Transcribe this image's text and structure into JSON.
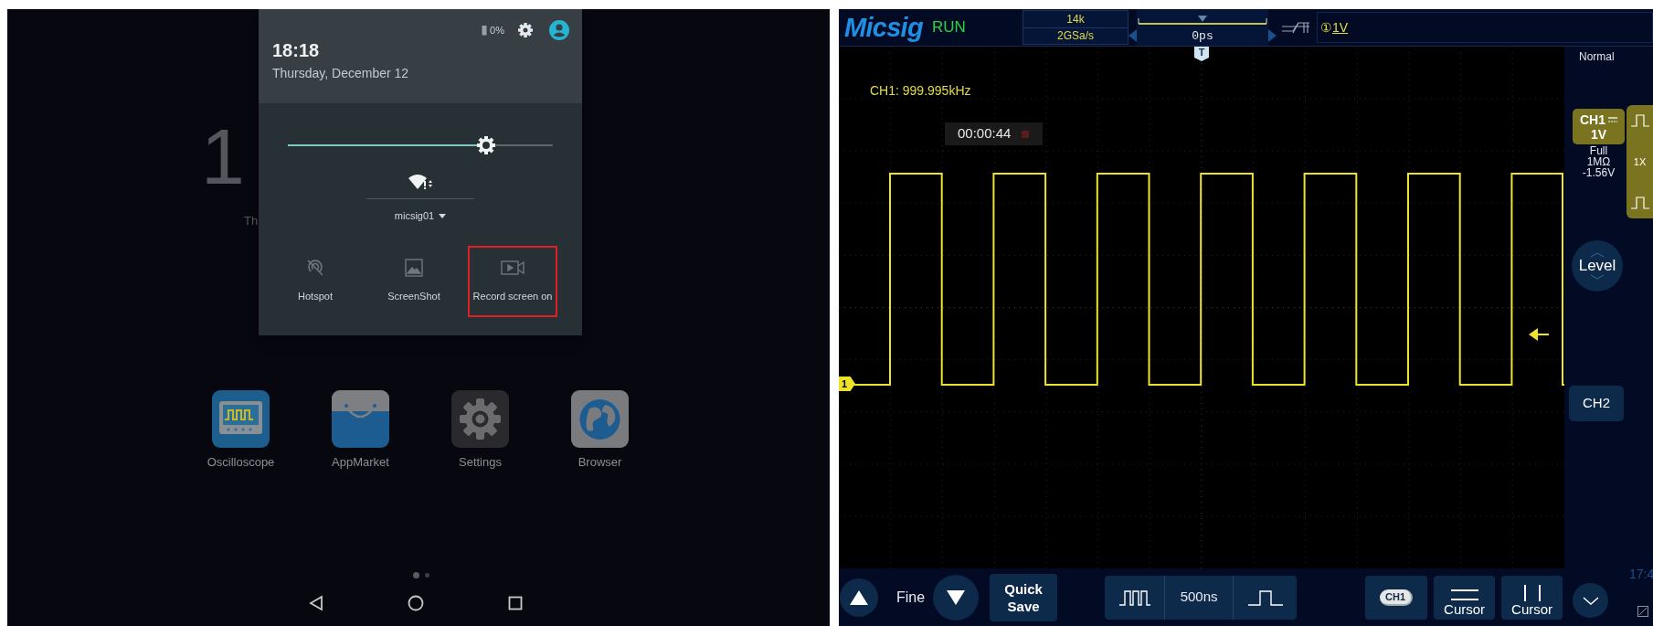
{
  "home": {
    "clock_fragment": "1",
    "date_fragment": "Th",
    "apps": [
      {
        "label": "Oscilloscope",
        "kind": "scope"
      },
      {
        "label": "AppMarket",
        "kind": "market"
      },
      {
        "label": "Settings",
        "kind": "settings"
      },
      {
        "label": "Browser",
        "kind": "browser"
      }
    ],
    "page_dots": [
      {
        "selected": true
      },
      {
        "selected": false
      }
    ]
  },
  "notification_shade": {
    "battery": "0%",
    "time": "18:18",
    "date": "Thursday, December 12",
    "brightness": {
      "level": 0.77
    },
    "wifi_network": "micsig01",
    "tiles": [
      {
        "label": "Hotspot",
        "kind": "hotspot",
        "selected": false
      },
      {
        "label": "ScreenShot",
        "kind": "screenshot",
        "selected": false
      },
      {
        "label": "Record screen on",
        "kind": "record",
        "selected": true
      }
    ]
  },
  "oscilloscope": {
    "brand": "Micsig",
    "run_state": "RUN",
    "memory_depth": "14k",
    "sample_rate": "2GSa/s",
    "trigger_position": "0ps",
    "trigger_channel": "①",
    "trigger_level": "1V",
    "measurement": "CH1: 999.995kHz",
    "record_time": "00:00:44",
    "channel_marker": "1",
    "trigger_marker": "T",
    "trigger_mode": "Normal",
    "ch1": {
      "label": "CH1",
      "scale": "1V",
      "bandwidth": "Full",
      "impedance": "1MΩ",
      "offset": "-1.56V"
    },
    "probe": "1X",
    "level_button": "Level",
    "ch2_button": "CH2",
    "clock_fragment": "17:4",
    "fine_label": "Fine",
    "quick_save": "Quick Save",
    "timebase": "500ns",
    "ch1_badge": "CH1",
    "cursor_buttons": [
      {
        "label": "Cursor",
        "kind": "horizontal"
      },
      {
        "label": "Cursor",
        "kind": "vertical"
      }
    ]
  }
}
